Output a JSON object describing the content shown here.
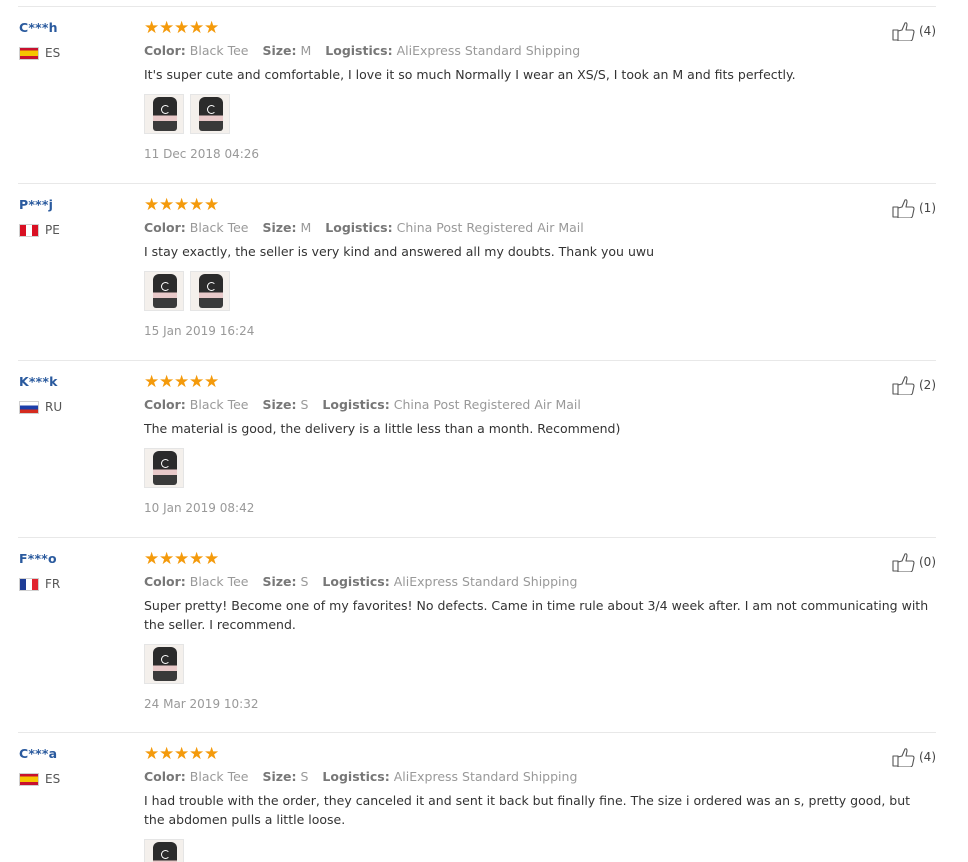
{
  "reviews": [
    {
      "buyer": "C***h",
      "country": "ES",
      "rating": 5,
      "color_label": "Color:",
      "color": "Black Tee",
      "size_label": "Size:",
      "size": "M",
      "logistics_label": "Logistics:",
      "logistics": "AliExpress Standard Shipping",
      "text": "It's super cute and comfortable, I love it so much Normally I wear an XS/S, I took an M and fits perfectly.",
      "photo_count": 2,
      "date": "11 Dec 2018 04:26",
      "helpful": "(4)"
    },
    {
      "buyer": "P***j",
      "country": "PE",
      "rating": 5,
      "color_label": "Color:",
      "color": "Black Tee",
      "size_label": "Size:",
      "size": "M",
      "logistics_label": "Logistics:",
      "logistics": "China Post Registered Air Mail",
      "text": "I stay exactly, the seller is very kind and answered all my doubts. Thank you uwu",
      "photo_count": 2,
      "date": "15 Jan 2019 16:24",
      "helpful": "(1)"
    },
    {
      "buyer": "K***k",
      "country": "RU",
      "rating": 5,
      "color_label": "Color:",
      "color": "Black Tee",
      "size_label": "Size:",
      "size": "S",
      "logistics_label": "Logistics:",
      "logistics": "China Post Registered Air Mail",
      "text": "The material is good, the delivery is a little less than a month. Recommend)",
      "photo_count": 1,
      "date": "10 Jan 2019 08:42",
      "helpful": "(2)"
    },
    {
      "buyer": "F***o",
      "country": "FR",
      "rating": 5,
      "color_label": "Color:",
      "color": "Black Tee",
      "size_label": "Size:",
      "size": "S",
      "logistics_label": "Logistics:",
      "logistics": "AliExpress Standard Shipping",
      "text": "Super pretty! Become one of my favorites! No defects. Came in time rule about 3/4 week after. I am not communicating with the seller. I recommend.",
      "photo_count": 1,
      "date": "24 Mar 2019 10:32",
      "helpful": "(0)"
    },
    {
      "buyer": "C***a",
      "country": "ES",
      "rating": 5,
      "color_label": "Color:",
      "color": "Black Tee",
      "size_label": "Size:",
      "size": "S",
      "logistics_label": "Logistics:",
      "logistics": "AliExpress Standard Shipping",
      "text": "I had trouble with the order, they canceled it and sent it back but finally fine. The size i ordered was an s, pretty good, but the abdomen pulls a little loose.",
      "photo_count": 1,
      "date": "",
      "helpful": "(4)"
    }
  ],
  "colors": {
    "buyer_name": "#2a5a9e",
    "star": "#f49a0b",
    "meta_text": "#999999",
    "divider": "#e8e8e8"
  },
  "icons": {
    "rating": "star-icon",
    "helpful": "thumbs-up-icon",
    "country": "flag-icon"
  }
}
